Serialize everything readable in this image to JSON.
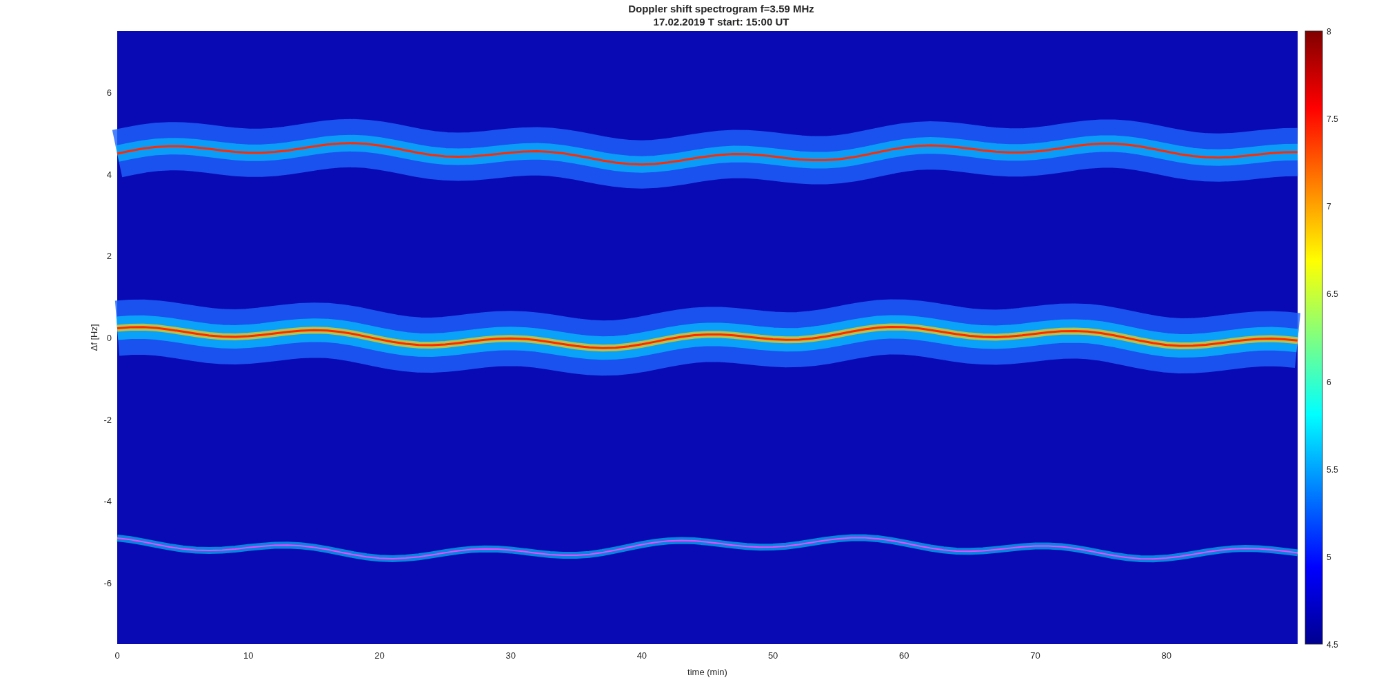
{
  "figure": {
    "title": [
      "Doppler shift spectrogram f=3.59 MHz",
      "17.02.2019   T start: 15:00 UT"
    ],
    "xlabel": "time (min)",
    "ylabel": "Δf [Hz]",
    "xticks": [
      "0",
      "10",
      "20",
      "30",
      "40",
      "50",
      "60",
      "70",
      "80"
    ],
    "yticks": [
      "6",
      "4",
      "2",
      "0",
      "-2",
      "-4",
      "-6"
    ],
    "colorbar_ticks": [
      "8",
      "7.5",
      "7",
      "6.5",
      "6",
      "5.5",
      "5",
      "4.5"
    ]
  }
}
